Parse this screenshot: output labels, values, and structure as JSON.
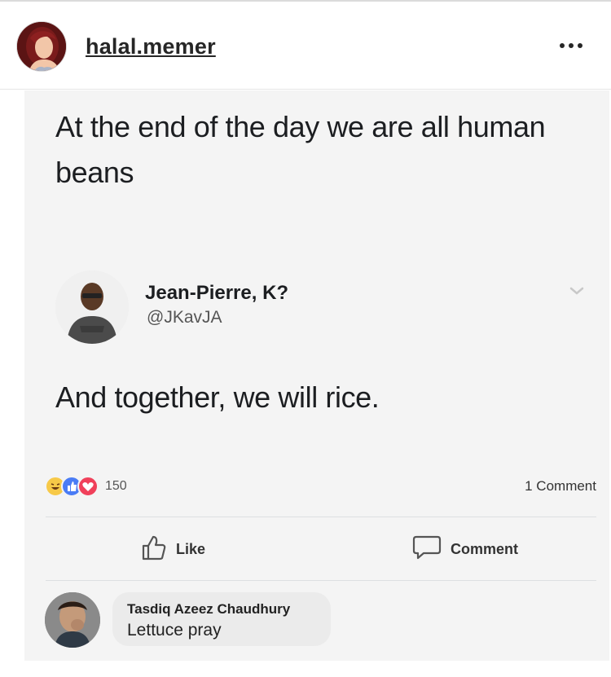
{
  "header": {
    "username": "halal.memer",
    "avatar_icon": "profile-avatar",
    "more_icon": "more-options-icon"
  },
  "post": {
    "text": "At the end of the day we are all human beans",
    "tweet": {
      "name": "Jean-Pierre, K?",
      "handle": "@JKavJA",
      "text": "And together, we will rice.",
      "chevron_icon": "chevron-down-icon"
    },
    "reactions": {
      "icons": [
        "haha-icon",
        "like-icon",
        "love-icon"
      ],
      "count": "150",
      "comment_count": "1 Comment"
    },
    "actions": {
      "like_label": "Like",
      "comment_label": "Comment"
    },
    "comment": {
      "author": "Tasdiq Azeez Chaudhury",
      "text": "Lettuce pray"
    }
  },
  "colors": {
    "like_blue": "#4a7cf5",
    "love_red": "#f0405a",
    "haha_yellow": "#f7c948",
    "text": "#1c1e21",
    "panel": "#f4f4f4"
  }
}
